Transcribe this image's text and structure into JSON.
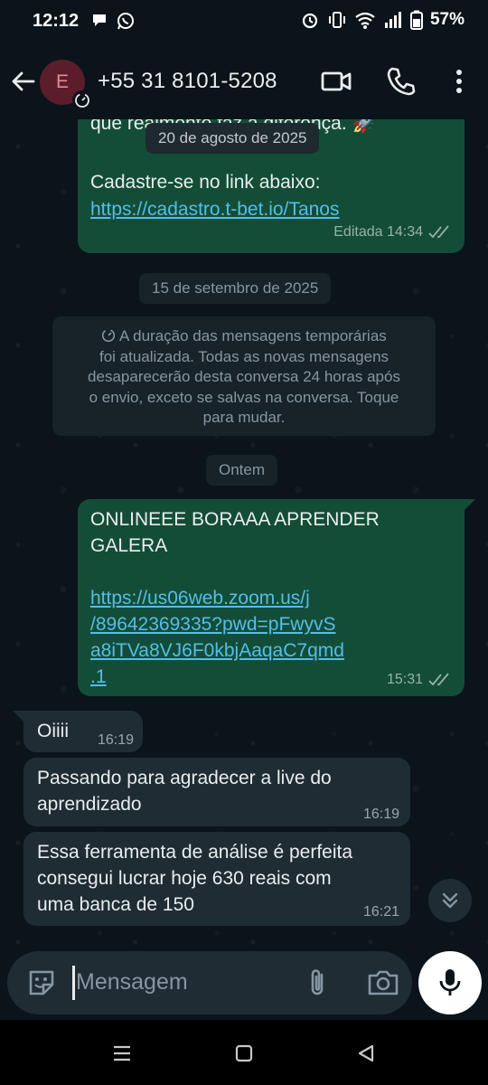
{
  "status_bar": {
    "time": "12:12",
    "battery": "57%"
  },
  "header": {
    "avatar_letter": "E",
    "contact": "+55 31 8101-5208"
  },
  "messages_top": {
    "partial_text": "que realmente faz a diferença. 🚀",
    "cta_text": "Cadastre-se no link abaixo:",
    "link": "https://cadastro.t-bet.io/Tanos",
    "edited_label": "Editada 14:34"
  },
  "date_chips": {
    "first": "20 de agosto de 2025",
    "second": "15 de setembro de 2025",
    "third": "Ontem"
  },
  "system_notice": {
    "line1": "A duração das mensagens temporárias",
    "line2": "foi atualizada. Todas as novas mensagens",
    "line3": "desaparecerão desta conversa 24 horas após",
    "line4": "o envio, exceto se salvas na conversa. Toque",
    "line5": "para mudar."
  },
  "outgoing_zoom": {
    "line1": "ONLINEEE BORAAA APRENDER",
    "line2": "GALERA",
    "link1": "https://us06web.zoom.us/j",
    "link2": "/89642369335?pwd=pFwyvS",
    "link3": "a8iTVa8VJ6F0kbjAaqaC7qmd",
    "link4": ".1",
    "time": "15:31"
  },
  "incoming": [
    {
      "lines": [
        "Oiiii"
      ],
      "time": "16:19"
    },
    {
      "lines": [
        "Passando para agradecer a live do",
        "aprendizado"
      ],
      "time": "16:19"
    },
    {
      "lines": [
        "Essa ferramenta de análise é perfeita",
        "consegui lucrar hoje 630 reais com",
        "uma banca de 150"
      ],
      "time": "16:21"
    }
  ],
  "composer": {
    "placeholder": "Mensagem"
  },
  "colors": {
    "outgoing_bubble": "#144d37",
    "incoming_bubble": "#1f2c34",
    "link": "#53bdeb",
    "background": "#0b141a"
  }
}
